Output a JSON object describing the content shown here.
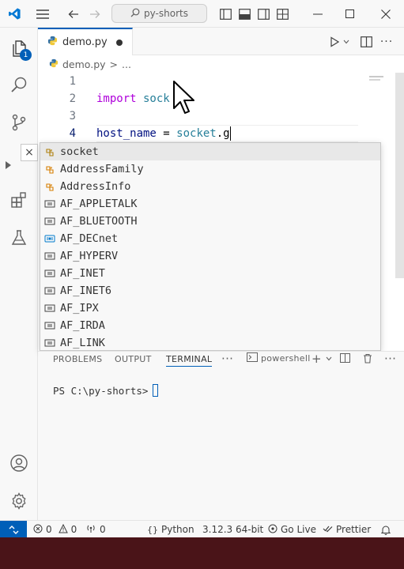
{
  "titlebar": {
    "search_text": "py-shorts",
    "icons": [
      "vscode-logo",
      "menu-icon",
      "back-arrow-icon",
      "forward-arrow-icon",
      "search-icon",
      "toggle-sidebar-icon",
      "toggle-panel-icon",
      "toggle-secondary-sidebar-icon",
      "customize-layout-icon",
      "minimize-icon",
      "maximize-icon",
      "close-icon"
    ]
  },
  "activitybar": {
    "explorer_badge": "1",
    "icons": [
      "explorer-icon",
      "search-icon",
      "source-control-icon",
      "run-debug-icon",
      "extensions-icon",
      "testing-icon",
      "accounts-icon",
      "settings-gear-icon"
    ]
  },
  "editor": {
    "tab_label": "demo.py",
    "breadcrumb_file": "demo.py",
    "breadcrumb_sep": ">",
    "breadcrumb_more": "...",
    "lines": [
      {
        "num": "1",
        "parts": []
      },
      {
        "num": "2",
        "parts": [
          {
            "t": "import",
            "c": "kw"
          },
          {
            "t": " sock",
            "c": "mod"
          }
        ]
      },
      {
        "num": "3",
        "parts": []
      },
      {
        "num": "4",
        "parts": [
          {
            "t": "host_name",
            "c": "var"
          },
          {
            "t": " = ",
            "c": ""
          },
          {
            "t": "socket",
            "c": "mod"
          },
          {
            "t": ".g",
            "c": ""
          }
        ]
      }
    ]
  },
  "suggest": {
    "close": "×",
    "items": [
      {
        "label": "socket",
        "kind": "module"
      },
      {
        "label": "AddressFamily",
        "kind": "class"
      },
      {
        "label": "AddressInfo",
        "kind": "class"
      },
      {
        "label": "AF_APPLETALK",
        "kind": "constant"
      },
      {
        "label": "AF_BLUETOOTH",
        "kind": "constant"
      },
      {
        "label": "AF_DECnet",
        "kind": "variable"
      },
      {
        "label": "AF_HYPERV",
        "kind": "constant"
      },
      {
        "label": "AF_INET",
        "kind": "constant"
      },
      {
        "label": "AF_INET6",
        "kind": "constant"
      },
      {
        "label": "AF_IPX",
        "kind": "constant"
      },
      {
        "label": "AF_IRDA",
        "kind": "constant"
      },
      {
        "label": "AF_LINK",
        "kind": "constant"
      }
    ]
  },
  "panel": {
    "tabs": [
      "PROBLEMS",
      "OUTPUT",
      "TERMINAL"
    ],
    "active_tab": "TERMINAL",
    "more": "···",
    "terminal_name": "powershell",
    "prompt": "PS C:\\py-shorts>"
  },
  "statusbar": {
    "errors": "0",
    "warnings": "0",
    "ports": "0",
    "language": "Python",
    "interpreter": "3.12.3 64-bit",
    "go_live": "Go Live",
    "prettier": "Prettier"
  },
  "colors": {
    "accent": "#005fb8",
    "keyword": "#af00db",
    "module": "#267f99",
    "variable": "#001080",
    "strip": "#4a1418"
  }
}
